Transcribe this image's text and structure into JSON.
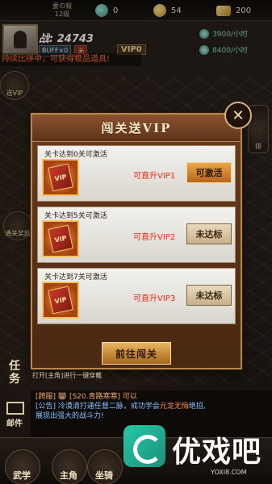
{
  "topbar": {
    "rank_title": "要の報",
    "rank_sub": "12级",
    "jade": "0",
    "coins": "54",
    "gold": "200"
  },
  "player": {
    "power": "战: 24743",
    "buff_label": "BUFF×0",
    "buff2_label": "无",
    "vip_label": "VIP0",
    "ticker": "持续比拼中，可获得极品道具!"
  },
  "income": {
    "line1": "3900/小时",
    "line2": "8400/小时"
  },
  "side_buttons": {
    "b1": "送VIP",
    "b2": "通关奖励",
    "b3": "排"
  },
  "modal": {
    "title": "闯关送VIP",
    "close_label": "✕",
    "cards": [
      {
        "condition": "关卡达到0关可激活",
        "reward_icon": "vip-book-icon",
        "desc": "可直升VIP1",
        "button": "可激活",
        "state": "active"
      },
      {
        "condition": "关卡达到5关可激活",
        "reward_icon": "vip-book-icon",
        "desc": "可直升VIP2",
        "button": "未达标",
        "state": "locked"
      },
      {
        "condition": "关卡达到7关可激活",
        "reward_icon": "vip-book-icon",
        "desc": "可直升VIP3",
        "button": "未达标",
        "state": "locked"
      }
    ],
    "go_button": "前往闯关"
  },
  "tip": "打开[主角]进行一键穿戴",
  "chat": {
    "line1": "[跨服] 🐻 [S20.青路寒寒] 可以",
    "line2_prefix": "[公告] 冷漠清打通任督二脉，成功学会",
    "line2_highlight": "元龙无悔",
    "line2_suffix": "绝招,",
    "line3": "展现出强大的战斗力!"
  },
  "side_labels": {
    "task": "任务",
    "mail": "邮件"
  },
  "bottom_nav": {
    "item1": "武学",
    "item2": "主角",
    "item3": "坐骑"
  },
  "watermark": {
    "text": "优戏吧",
    "sub": "YOXI8.COM"
  },
  "colors": {
    "modal_bg": "#6b3a1e",
    "accent_red": "#e82a1a",
    "button_gold": "#e9a64a"
  }
}
